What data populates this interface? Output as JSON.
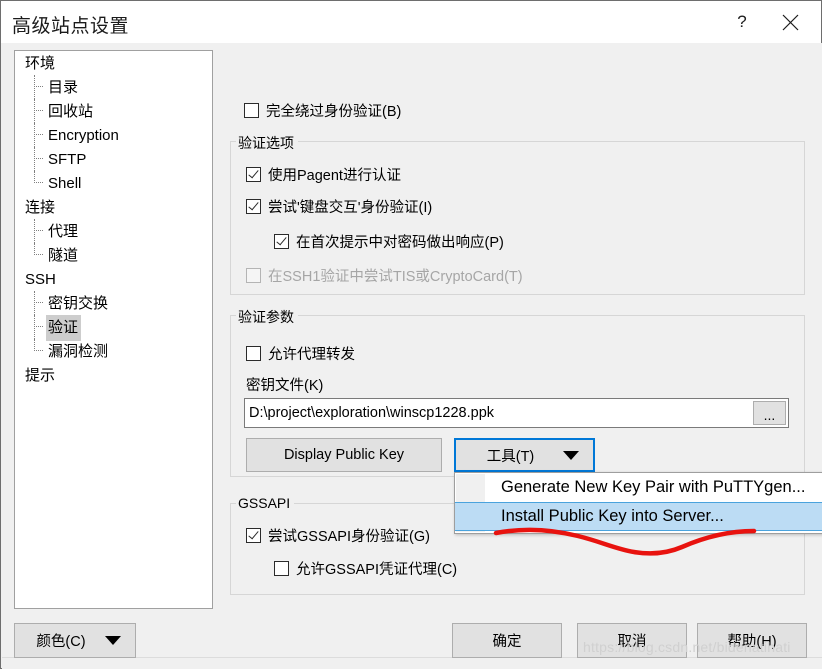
{
  "window": {
    "title": "高级站点设置",
    "help_caption": "?",
    "close_caption": "✕"
  },
  "tree": {
    "items": [
      {
        "label": "环境",
        "level": 0,
        "selected": false
      },
      {
        "label": "目录",
        "level": 1,
        "selected": false
      },
      {
        "label": "回收站",
        "level": 1,
        "selected": false
      },
      {
        "label": "Encryption",
        "level": 1,
        "selected": false
      },
      {
        "label": "SFTP",
        "level": 1,
        "selected": false
      },
      {
        "label": "Shell",
        "level": 1,
        "selected": false
      },
      {
        "label": "连接",
        "level": 0,
        "selected": false
      },
      {
        "label": "代理",
        "level": 1,
        "selected": false
      },
      {
        "label": "隧道",
        "level": 1,
        "selected": false
      },
      {
        "label": "SSH",
        "level": 0,
        "selected": false
      },
      {
        "label": "密钥交换",
        "level": 1,
        "selected": false
      },
      {
        "label": "验证",
        "level": 1,
        "selected": true
      },
      {
        "label": "漏洞检测",
        "level": 1,
        "selected": false
      },
      {
        "label": "提示",
        "level": 0,
        "selected": false
      }
    ]
  },
  "panel": {
    "bypass_auth": {
      "label": "完全绕过身份验证(B)",
      "checked": false,
      "disabled": false
    },
    "auth_options": {
      "title": "验证选项",
      "items": [
        {
          "label": "使用Pagent进行认证",
          "checked": true,
          "disabled": false
        },
        {
          "label": "尝试'键盘交互'身份验证(I)",
          "checked": true,
          "disabled": false
        },
        {
          "label": "在首次提示中对密码做出响应(P)",
          "checked": true,
          "disabled": false
        },
        {
          "label": "在SSH1验证中尝试TIS或CryptoCard(T)",
          "checked": false,
          "disabled": true
        }
      ]
    },
    "auth_params": {
      "title": "验证参数",
      "agent_forward": {
        "label": "允许代理转发",
        "checked": false
      },
      "keyfile_label": "密钥文件(K)",
      "keyfile_value": "D:\\project\\exploration\\winscp1228.ppk",
      "browse_label": "...",
      "display_public_key_label": "Display Public Key",
      "tools_label": "工具(T)"
    },
    "gssapi": {
      "title": "GSSAPI",
      "items": [
        {
          "label": "尝试GSSAPI身份验证(G)",
          "checked": true
        },
        {
          "label": "允许GSSAPI凭证代理(C)",
          "checked": false
        }
      ]
    }
  },
  "tools_menu": {
    "items": [
      {
        "label": "Generate New Key Pair with PuTTYgen...",
        "highlighted": false
      },
      {
        "label": "Install Public Key into Server...",
        "highlighted": true
      }
    ]
  },
  "footer": {
    "color_label": "颜色(C)",
    "ok_label": "确定",
    "cancel_label": "取消",
    "help_label": "帮助(H)"
  },
  "watermark": {
    "text": "https://blog.csdn.net/bidenatihati"
  },
  "colors": {
    "accent": "#0078d7",
    "menu_highlight": "#bcdcf4",
    "annotation": "#e8130f",
    "dialog_bg": "#f0f0f0"
  }
}
